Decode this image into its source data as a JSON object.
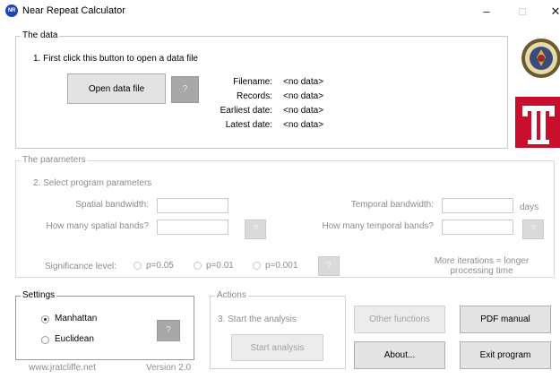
{
  "window": {
    "title": "Near Repeat Calculator",
    "app_icon_text": "NR",
    "minimize_glyph": "–",
    "maximize_glyph": "□",
    "close_glyph": "✕"
  },
  "data_group": {
    "legend": "The data",
    "instruction": "1. First click this button to open a data file",
    "open_button": "Open data file",
    "help": "?",
    "labels": {
      "filename": "Filename:",
      "records": "Records:",
      "earliest": "Earliest date:",
      "latest": "Latest date:"
    },
    "values": {
      "filename": "<no data>",
      "records": "<no data>",
      "earliest": "<no data>",
      "latest": "<no data>"
    }
  },
  "params_group": {
    "legend": "The parameters",
    "instruction": "2. Select program parameters",
    "spatial_bandwidth_label": "Spatial bandwidth:",
    "spatial_bands_label": "How many spatial bands?",
    "temporal_bandwidth_label": "Temporal bandwidth:",
    "temporal_bands_label": "How many temporal bands?",
    "days_label": "days",
    "spatial_bandwidth_value": "",
    "spatial_bands_value": "",
    "temporal_bandwidth_value": "",
    "temporal_bands_value": "",
    "help": "?",
    "significance_label": "Significance level:",
    "significance_options": [
      "p=0.05",
      "p=0.01",
      "p=0.001"
    ],
    "iterations_note_line1": "More iterations = longer",
    "iterations_note_line2": "processing time"
  },
  "settings_group": {
    "legend": "Settings",
    "options": [
      "Manhattan",
      "Euclidean"
    ],
    "selected": "Manhattan",
    "help": "?",
    "website": "www.jratcliffe.net",
    "version": "Version 2.0"
  },
  "actions_group": {
    "legend": "Actions",
    "instruction": "3. Start the analysis",
    "start_button": "Start analysis"
  },
  "side_buttons": {
    "other_functions": "Other functions",
    "pdf_manual": "PDF manual",
    "about": "About...",
    "exit": "Exit program"
  },
  "colors": {
    "app_icon": "#1a47b8",
    "temple_red": "#c8102e"
  }
}
